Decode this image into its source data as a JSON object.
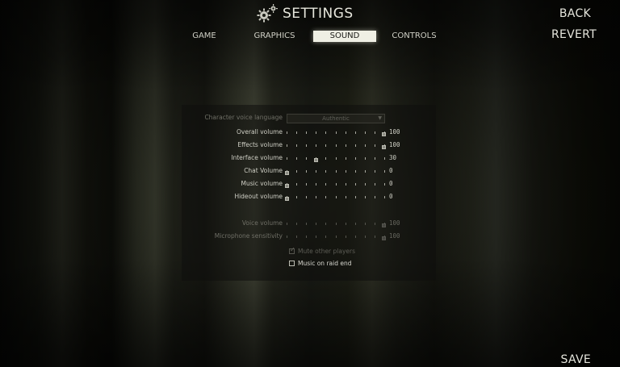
{
  "header": {
    "title": "SETTINGS"
  },
  "tabs": [
    {
      "label": "GAME",
      "active": false
    },
    {
      "label": "GRAPHICS",
      "active": false
    },
    {
      "label": "SOUND",
      "active": true
    },
    {
      "label": "CONTROLS",
      "active": false
    }
  ],
  "corner": {
    "back": "BACK",
    "revert": "REVERT",
    "save": "SAVE"
  },
  "sound": {
    "voice_language": {
      "label": "Character voice language",
      "value": "Authentic"
    },
    "sliders": [
      {
        "label": "Overall volume",
        "value": "100",
        "level": 1.0,
        "enabled": true
      },
      {
        "label": "Effects volume",
        "value": "100",
        "level": 1.0,
        "enabled": true
      },
      {
        "label": "Interface volume",
        "value": "30",
        "level": 0.3,
        "enabled": true
      },
      {
        "label": "Chat Volume",
        "value": "0",
        "level": 0.0,
        "enabled": true
      },
      {
        "label": "Music volume",
        "value": "0",
        "level": 0.0,
        "enabled": true
      },
      {
        "label": "Hideout volume",
        "value": "0",
        "level": 0.0,
        "enabled": true
      },
      {
        "label": "Voice volume",
        "value": "100",
        "level": 1.0,
        "enabled": false
      },
      {
        "label": "Microphone sensitivity",
        "value": "100",
        "level": 1.0,
        "enabled": false
      }
    ],
    "mute_other_players": {
      "label": "Mute other players",
      "checked": true,
      "enabled": false
    },
    "music_on_raid_end": {
      "label": "Music on raid end",
      "checked": false,
      "enabled": true
    }
  }
}
